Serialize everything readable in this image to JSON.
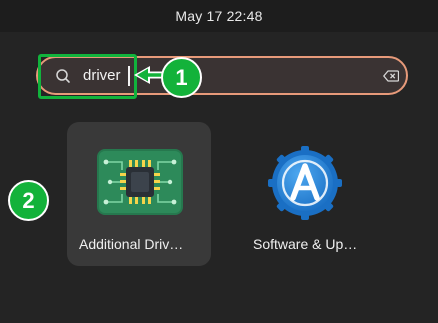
{
  "topbar": {
    "clock": "May 17  22:48"
  },
  "search": {
    "value": "driver",
    "search_icon": "search-icon",
    "clear_icon": "backspace-clear-icon",
    "border_color": "#e79a7a"
  },
  "annotations": {
    "badge_1": "1",
    "badge_2": "2",
    "accent": "#13b23a"
  },
  "results": [
    {
      "label": "Additional Driv…",
      "icon": "chip-icon",
      "selected": true
    },
    {
      "label": "Software & Up…",
      "icon": "software-updates-icon",
      "selected": false
    }
  ]
}
